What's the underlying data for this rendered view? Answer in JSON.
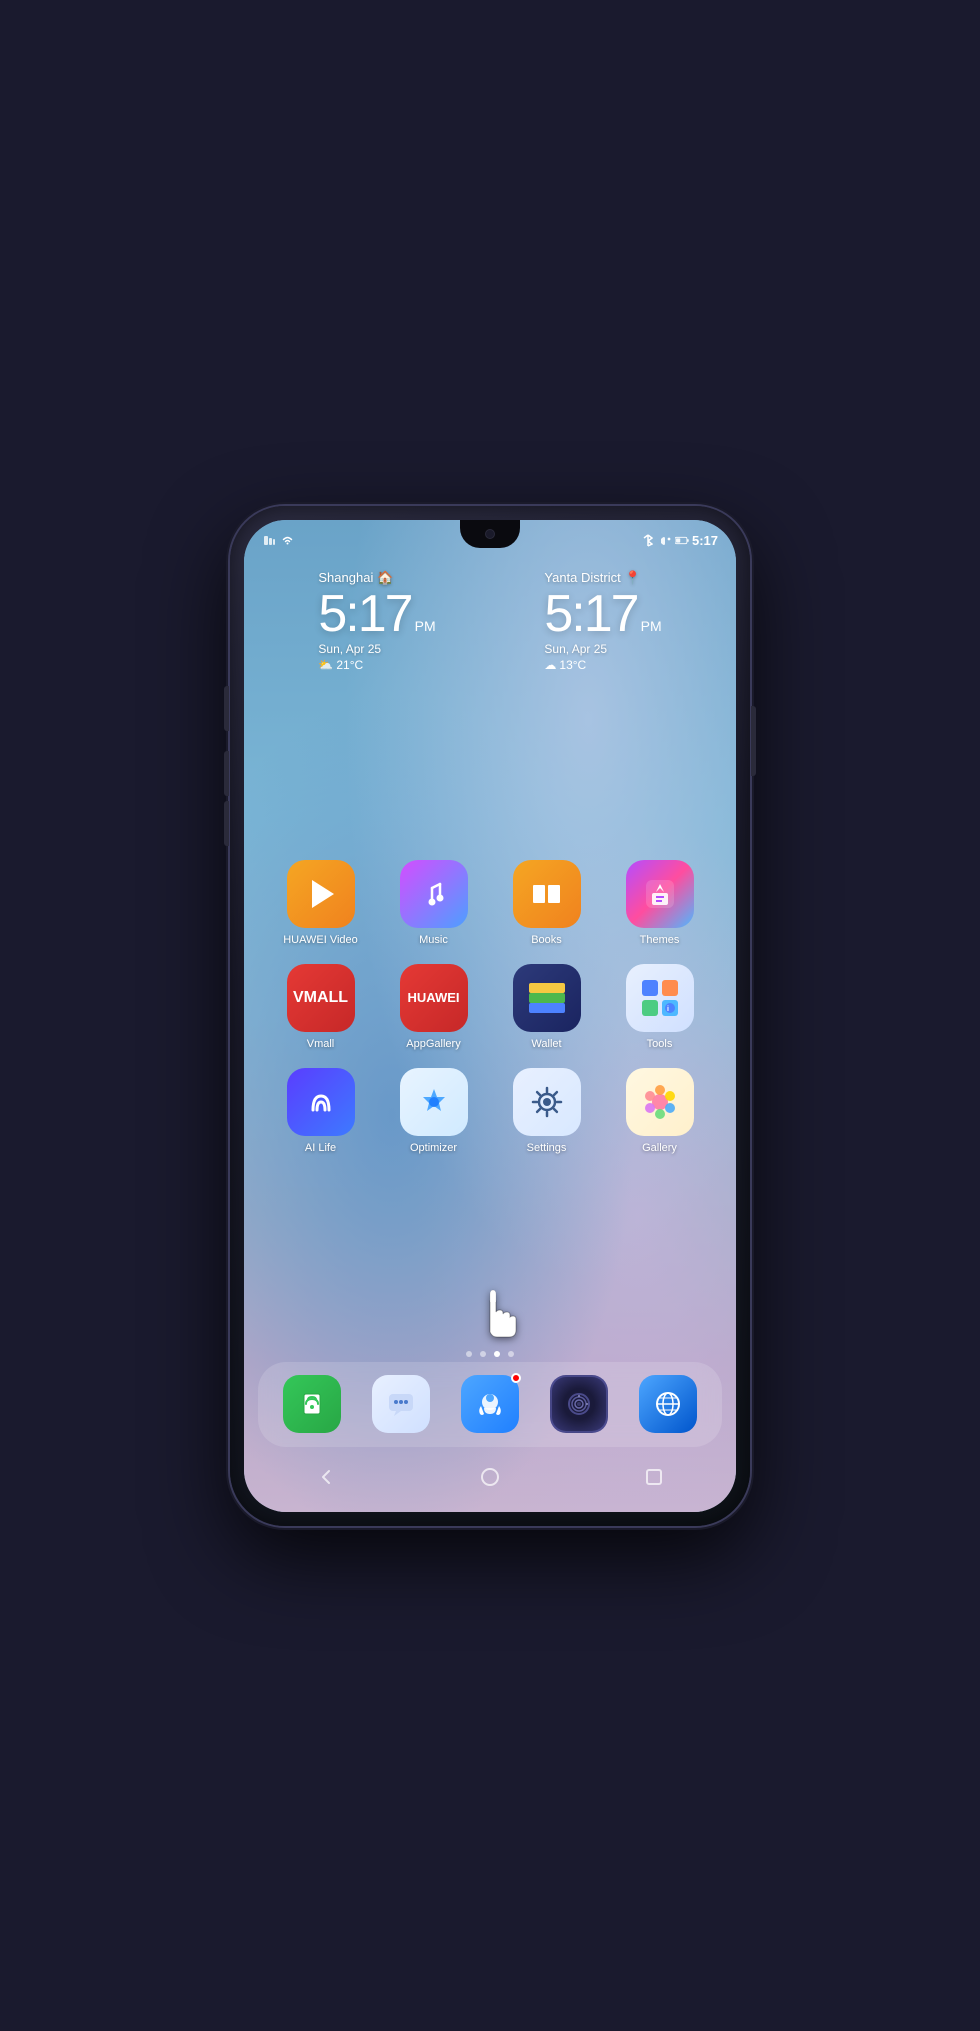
{
  "phone": {
    "status_bar": {
      "left_icons": [
        "sim-icon",
        "wifi-icon"
      ],
      "right_icons": [
        "bluetooth-icon",
        "mute-icon",
        "battery-icon"
      ],
      "battery": "42",
      "time": "5:17"
    },
    "clock_widgets": [
      {
        "city": "Shanghai",
        "city_icon": "🏠",
        "time": "5:17",
        "ampm": "PM",
        "date": "Sun, Apr 25",
        "weather_icon": "⛅",
        "temperature": "21°C"
      },
      {
        "city": "Yanta District",
        "city_icon": "📍",
        "time": "5:17",
        "ampm": "PM",
        "date": "Sun, Apr 25",
        "weather_icon": "☁",
        "temperature": "13°C"
      }
    ],
    "apps": [
      [
        {
          "id": "huawei-video",
          "label": "HUAWEI Video",
          "icon_class": "icon-huawei-video"
        },
        {
          "id": "music",
          "label": "Music",
          "icon_class": "icon-music"
        },
        {
          "id": "books",
          "label": "Books",
          "icon_class": "icon-books"
        },
        {
          "id": "themes",
          "label": "Themes",
          "icon_class": "icon-themes"
        }
      ],
      [
        {
          "id": "vmall",
          "label": "Vmall",
          "icon_class": "icon-vmall"
        },
        {
          "id": "appgallery",
          "label": "AppGallery",
          "icon_class": "icon-appgallery"
        },
        {
          "id": "wallet",
          "label": "Wallet",
          "icon_class": "icon-wallet"
        },
        {
          "id": "tools",
          "label": "Tools",
          "icon_class": "icon-tools"
        }
      ],
      [
        {
          "id": "ai-life",
          "label": "AI Life",
          "icon_class": "icon-ai-life"
        },
        {
          "id": "optimizer",
          "label": "Optimizer",
          "icon_class": "icon-optimizer"
        },
        {
          "id": "settings",
          "label": "Settings",
          "icon_class": "icon-settings"
        },
        {
          "id": "gallery",
          "label": "Gallery",
          "icon_class": "icon-gallery"
        }
      ]
    ],
    "page_dots": [
      {
        "active": false
      },
      {
        "active": false
      },
      {
        "active": true
      },
      {
        "active": false
      }
    ],
    "dock": [
      {
        "id": "phone",
        "icon_class": "dock-phone"
      },
      {
        "id": "messages",
        "icon_class": "dock-messages"
      },
      {
        "id": "support",
        "icon_class": "dock-support"
      },
      {
        "id": "camera",
        "icon_class": "dock-camera"
      },
      {
        "id": "browser",
        "icon_class": "dock-browser"
      }
    ],
    "nav": {
      "back": "◁",
      "home": "○",
      "recent": "□"
    }
  }
}
